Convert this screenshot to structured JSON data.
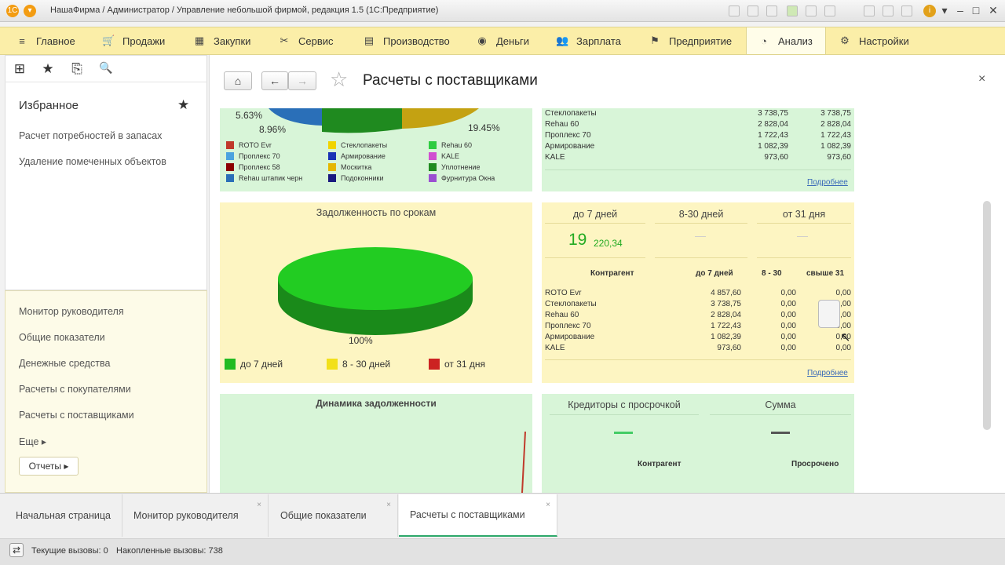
{
  "title_bar": {
    "text": "НашаФирма / Администратор / Управление небольшой фирмой, редакция 1.5  (1С:Предприятие)",
    "icons": [
      "app-logo-icon",
      "app-menu-icon",
      "calendar-icon",
      "calculator-icon",
      "copy-icon",
      "history-icon",
      "bookmark-icon",
      "zoom-icon",
      "info-icon",
      "minimize-icon",
      "restore-icon",
      "close-icon"
    ]
  },
  "menu": {
    "items": [
      {
        "label": "Главное",
        "icon": "≡"
      },
      {
        "label": "Продажи",
        "icon": "🛒"
      },
      {
        "label": "Закупки",
        "icon": "▦"
      },
      {
        "label": "Сервис",
        "icon": "✂"
      },
      {
        "label": "Производство",
        "icon": "▤"
      },
      {
        "label": "Деньги",
        "icon": "◉"
      },
      {
        "label": "Зарплата",
        "icon": "👥"
      },
      {
        "label": "Предприятие",
        "icon": "⚑"
      },
      {
        "label": "Анализ",
        "icon": "◔"
      },
      {
        "label": "Настройки",
        "icon": "⚙"
      }
    ]
  },
  "sidebar": {
    "tools": [
      "⊞",
      "★",
      "⎘",
      "🔍"
    ],
    "favorites_title": "Избранное",
    "favorites": [
      "Расчет потребностей в запасах",
      "Удаление помеченных объектов"
    ],
    "sections": [
      "Монитор руководителя",
      "Общие показатели",
      "Денежные средства",
      "Расчеты с покупателями",
      "Расчеты с поставщиками",
      "Еще ▸"
    ],
    "reports_button": "Отчеты ▸"
  },
  "header": {
    "title": "Расчеты с поставщиками",
    "home": "⌂",
    "back": "←",
    "forward": "→",
    "star": "☆",
    "close": "×"
  },
  "pie_top": {
    "labels": [
      "5.63%",
      "8.96%",
      "19.45%"
    ],
    "legend": [
      {
        "label": "ROTO Evr",
        "color": "#c0392b"
      },
      {
        "label": "Стеклопакеты",
        "color": "#f1d400"
      },
      {
        "label": "Rehau 60",
        "color": "#2ecc40"
      },
      {
        "label": "Проплекс 70",
        "color": "#4aa3df"
      },
      {
        "label": "Армирование",
        "color": "#1a33b5"
      },
      {
        "label": "KALE",
        "color": "#d04ed0"
      },
      {
        "label": "Проплекс 58",
        "color": "#8b0000"
      },
      {
        "label": "Москитка",
        "color": "#e5b700"
      },
      {
        "label": "Уплотнение",
        "color": "#1f8a1f"
      },
      {
        "label": "Rehau штапик черн",
        "color": "#2a6fb8"
      },
      {
        "label": "Подоконники",
        "color": "#1a1a80"
      },
      {
        "label": "Фурнитура Окна",
        "color": "#9b4fd1"
      }
    ]
  },
  "top_table": {
    "rows": [
      {
        "name": "Стеклопакеты",
        "a": "3 738,75",
        "b": "3 738,75"
      },
      {
        "name": "Rehau 60",
        "a": "2 828,04",
        "b": "2 828,04"
      },
      {
        "name": "Проплекс 70",
        "a": "1 722,43",
        "b": "1 722,43"
      },
      {
        "name": "Армирование",
        "a": "1 082,39",
        "b": "1 082,39"
      },
      {
        "name": "KALE",
        "a": "973,60",
        "b": "973,60"
      }
    ],
    "more": "Подробнее"
  },
  "debt_by_term": {
    "title": "Задолженность по срокам",
    "pie_label": "100%",
    "legend": [
      {
        "label": "до 7 дней",
        "color": "#22bb22"
      },
      {
        "label": "8 - 30 дней",
        "color": "#f2e01a"
      },
      {
        "label": "от 31 дня",
        "color": "#cc2222"
      }
    ]
  },
  "debt_summary": {
    "headers": [
      "до 7 дней",
      "8-30 дней",
      "от 31 дня"
    ],
    "value_big": "19",
    "value_small": "220,34",
    "dash2": "—",
    "dash3": "—",
    "table_headers": [
      "Контрагент",
      "до 7 дней",
      "8 - 30",
      "свыше 31"
    ],
    "rows": [
      {
        "name": "ROTO Evr",
        "a": "4 857,60",
        "b": "0,00",
        "c": "0,00"
      },
      {
        "name": "Стеклопакеты",
        "a": "3 738,75",
        "b": "0,00",
        "c": "0,00"
      },
      {
        "name": "Rehau 60",
        "a": "2 828,04",
        "b": "0,00",
        "c": "0,00"
      },
      {
        "name": "Проплекс 70",
        "a": "1 722,43",
        "b": "0,00",
        "c": "0,00"
      },
      {
        "name": "Армирование",
        "a": "1 082,39",
        "b": "0,00",
        "c": "0,00"
      },
      {
        "name": "KALE",
        "a": "973,60",
        "b": "0,00",
        "c": "0,00"
      }
    ],
    "more": "Подробнее"
  },
  "dynamics": {
    "title": "Динамика задолженности"
  },
  "overdue": {
    "headers": [
      "Кредиторы с просрочкой",
      "Сумма"
    ],
    "sub_headers": [
      "Контрагент",
      "Просрочено"
    ]
  },
  "tabs": [
    {
      "label": "Начальная страница"
    },
    {
      "label": "Монитор руководителя"
    },
    {
      "label": "Общие показатели"
    },
    {
      "label": "Расчеты с поставщиками"
    }
  ],
  "status": {
    "current_calls": "Текущие вызовы: 0",
    "accumulated_calls": "Накопленные вызовы: 738"
  }
}
